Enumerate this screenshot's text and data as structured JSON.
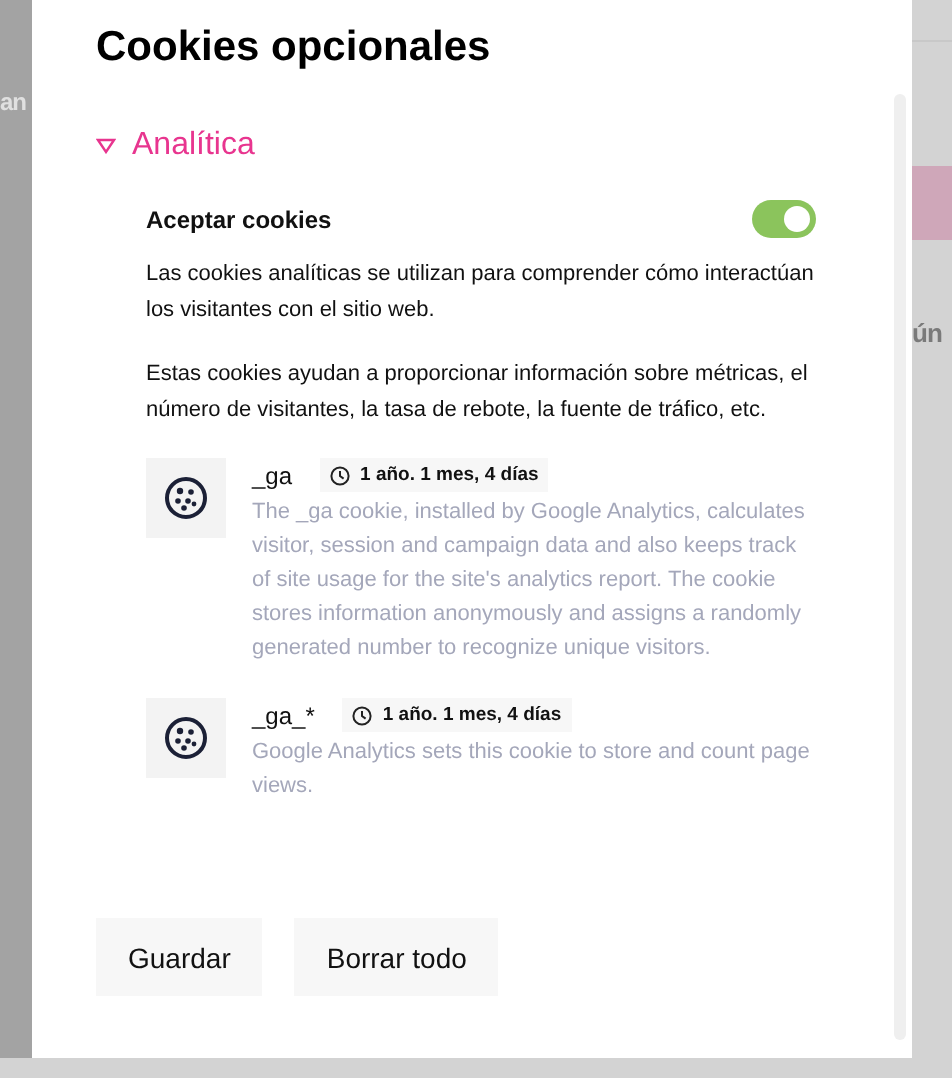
{
  "background": {
    "left_fragment": "an",
    "right_fragment": "ún"
  },
  "modal": {
    "title": "Cookies opcionales",
    "section": {
      "label": "Analítica",
      "expanded": true,
      "accept": {
        "label": "Aceptar cookies",
        "on": true
      },
      "paragraphs": [
        "Las cookies analíticas se utilizan para comprender cómo interactúan los visitantes con el sitio web.",
        "Estas cookies ayudan a proporcionar información sobre métricas, el número de visitantes, la tasa de rebote, la fuente de tráfico, etc."
      ],
      "cookies": [
        {
          "name": "_ga",
          "duration": "1 año. 1 mes, 4 días",
          "description": "The _ga cookie, installed by Google Analytics, calculates visitor, session and campaign data and also keeps track of site usage for the site's analytics report. The cookie stores information anonymously and assigns a randomly generated number to recognize unique visitors."
        },
        {
          "name": "_ga_*",
          "duration": "1 año. 1 mes, 4 días",
          "description": "Google Analytics sets this cookie to store and count page views."
        }
      ]
    },
    "buttons": [
      "Guardar",
      "Borrar todo"
    ]
  }
}
